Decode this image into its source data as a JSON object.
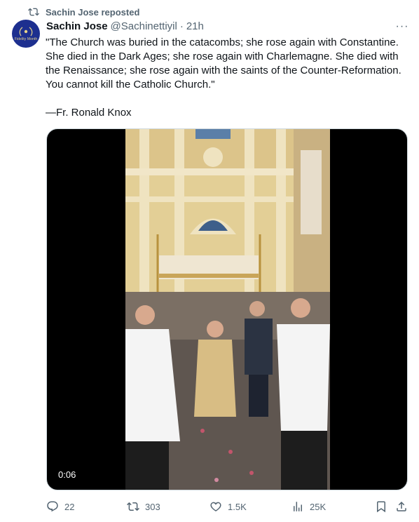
{
  "repost": {
    "text": "Sachin Jose reposted",
    "icon": "repost-icon"
  },
  "author": {
    "avatar_text": "Fidelity Month",
    "name": "Sachin Jose",
    "handle": "@Sachinettiyil",
    "dot": "·",
    "time": "21h"
  },
  "more": {
    "label": "···"
  },
  "tweet": {
    "quote": "\"The Church was buried in the catacombs; she rose again with Constantine. She died in the Dark Ages; she rose again with Charlemagne. She died with the Renaissance; she rose again with the saints of the Counter-Reformation. You cannot kill the Catholic Church.\"",
    "attribution": "—Fr. Ronald Knox"
  },
  "media": {
    "duration": "0:06"
  },
  "actions": {
    "replies": "22",
    "reposts": "303",
    "likes": "1.5K",
    "views": "25K"
  },
  "colors": {
    "text": "#0f1419",
    "muted": "#536471",
    "avatar_bg": "#1d2f8f"
  }
}
